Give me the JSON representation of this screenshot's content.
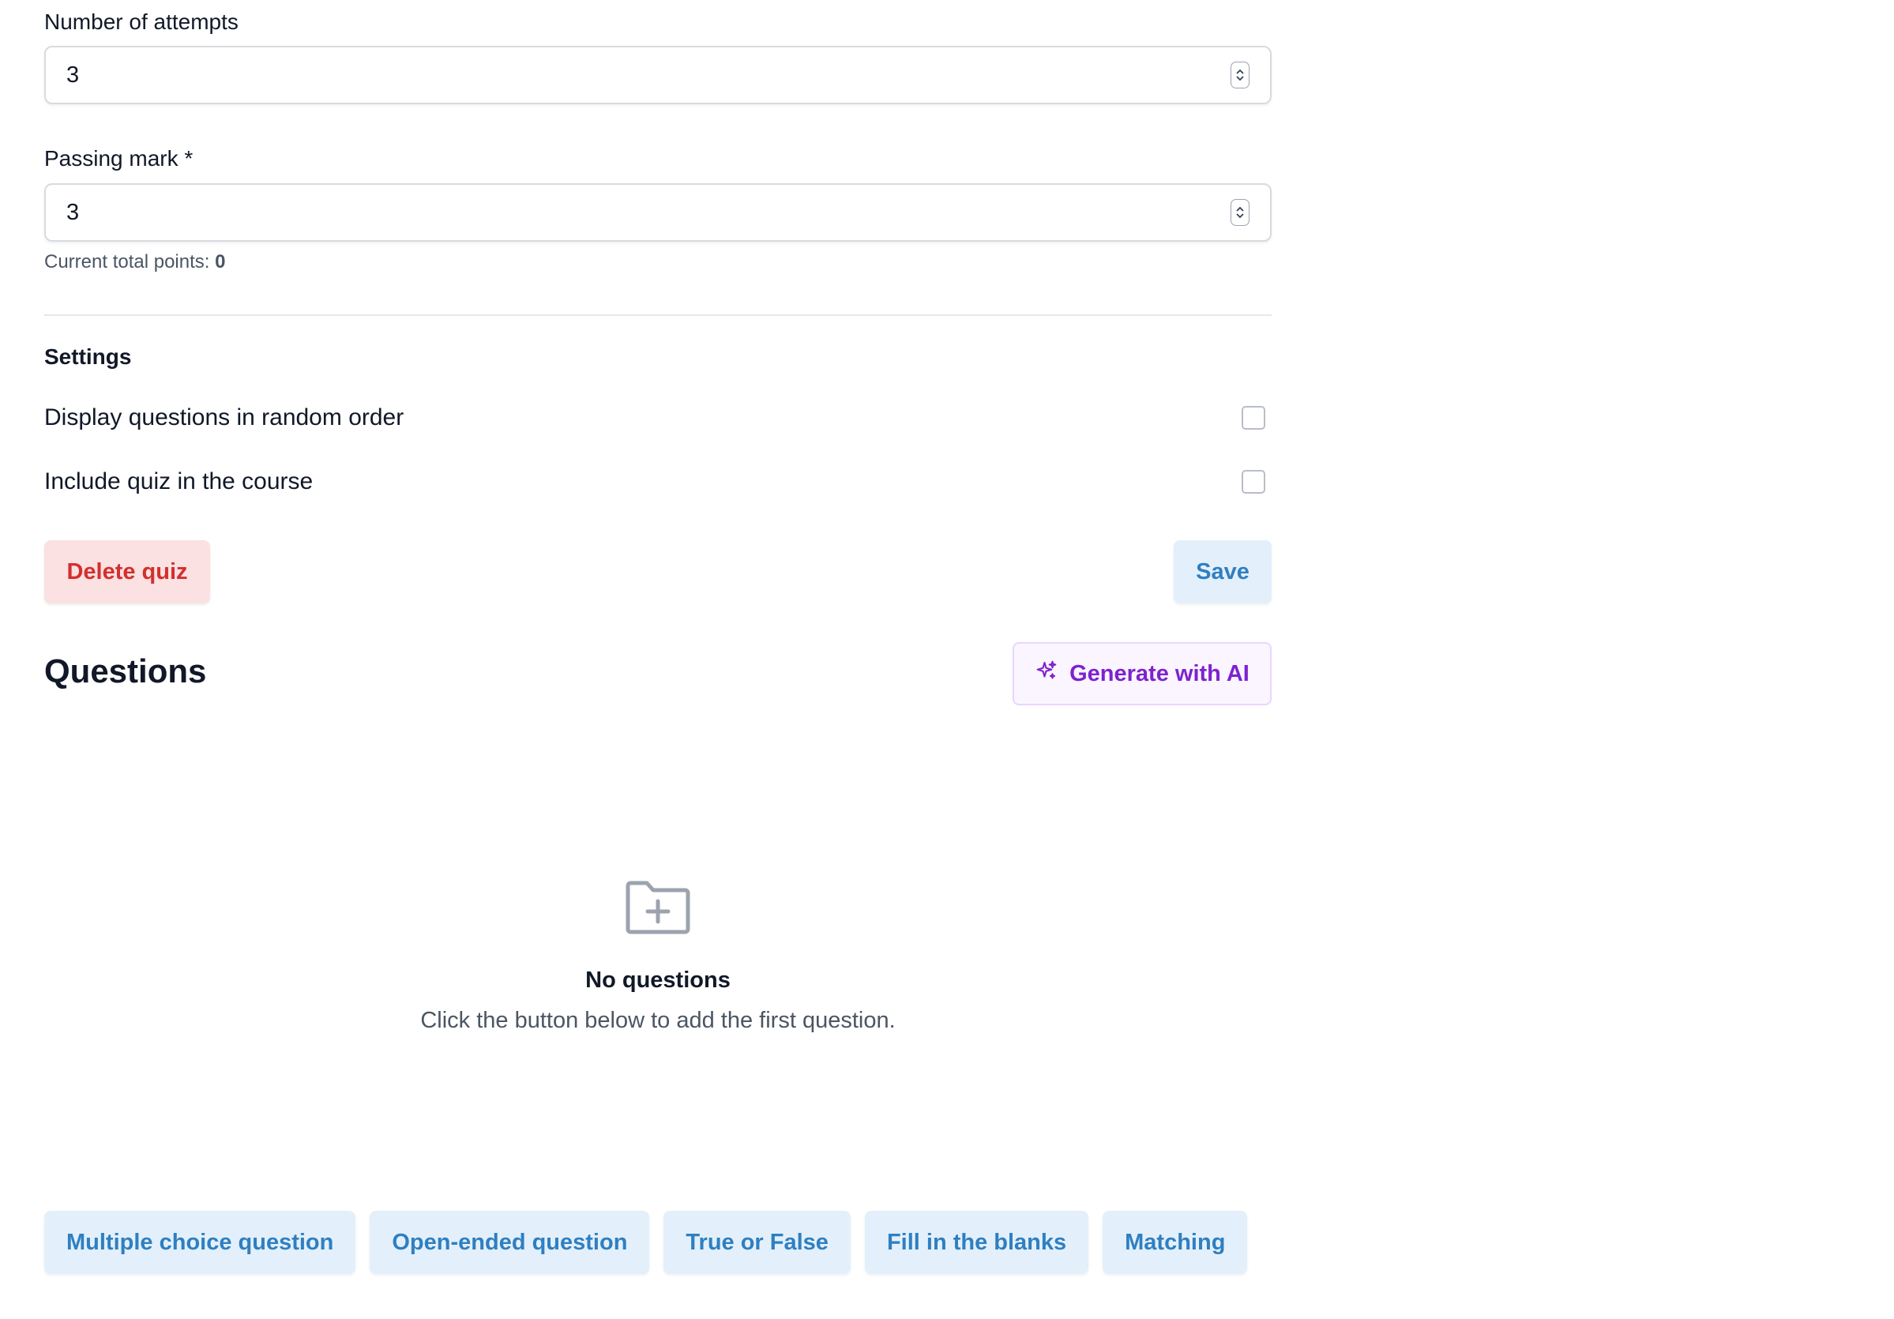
{
  "attempts": {
    "label": "Number of attempts",
    "value": "3"
  },
  "passing_mark": {
    "label": "Passing mark *",
    "value": "3",
    "hint_prefix": "Current total points:",
    "hint_value": "0"
  },
  "settings": {
    "title": "Settings",
    "items": [
      {
        "label": "Display questions in random order",
        "checked": false
      },
      {
        "label": "Include quiz in the course",
        "checked": false
      }
    ]
  },
  "actions": {
    "delete_label": "Delete quiz",
    "save_label": "Save"
  },
  "questions": {
    "title": "Questions",
    "generate_label": "Generate with AI",
    "empty_title": "No questions",
    "empty_desc": "Click the button below to add the first question.",
    "types": [
      "Multiple choice question",
      "Open-ended question",
      "True or False",
      "Fill in the blanks",
      "Matching"
    ]
  },
  "colors": {
    "danger_bg": "#fbe1e1",
    "danger_text": "#d32f2f",
    "primary_bg": "#e3f0fb",
    "primary_text": "#2f7fc1",
    "ai_bg": "#faf5ff",
    "ai_text": "#7e22ce"
  },
  "icons": {
    "spinner": "number-stepper-icon",
    "ai": "sparkles-icon",
    "empty": "folder-plus-icon"
  }
}
